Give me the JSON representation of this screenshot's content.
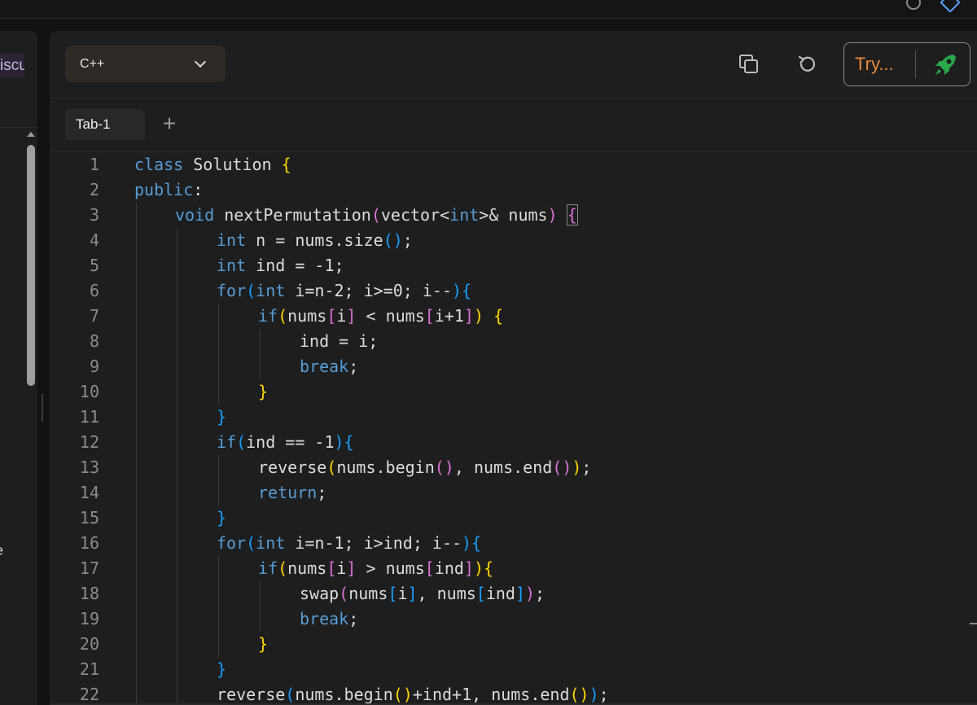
{
  "left_panel": {
    "tab_label": "iscu"
  },
  "editor": {
    "language": "C++",
    "try_label": "Try...",
    "tabs": [
      {
        "label": "Tab-1"
      }
    ],
    "add_tab_label": "+",
    "code_lines": [
      {
        "n": "1",
        "indent": 0,
        "html": "<span class=\"kw\">class</span> Solution <span class=\"b1\">{</span>"
      },
      {
        "n": "2",
        "indent": 0,
        "html": "<span class=\"kw\">public</span>:"
      },
      {
        "n": "3",
        "indent": 1,
        "html": "<span class=\"kw\">void</span> nextPermutation<span class=\"b2\">(</span>vector&lt;<span class=\"kw\">int</span>&gt;&amp; nums<span class=\"b2\">)</span> <span class=\"b2 hl\">{</span>"
      },
      {
        "n": "4",
        "indent": 2,
        "html": "<span class=\"kw\">int</span> n = nums.size<span class=\"b3\">()</span>;"
      },
      {
        "n": "5",
        "indent": 2,
        "html": "<span class=\"kw\">int</span> ind = -1;"
      },
      {
        "n": "6",
        "indent": 2,
        "html": "<span class=\"kw\">for</span><span class=\"b3\">(</span><span class=\"kw\">int</span> i=n-2; i&gt;=0; i--<span class=\"b3\">){</span>"
      },
      {
        "n": "7",
        "indent": 3,
        "html": "<span class=\"kw\">if</span><span class=\"b1\">(</span>nums<span class=\"b2\">[</span>i<span class=\"b2\">]</span> &lt; nums<span class=\"b2\">[</span>i+1<span class=\"b2\">]</span><span class=\"b1\">)</span> <span class=\"b1\">{</span>"
      },
      {
        "n": "8",
        "indent": 4,
        "html": "ind = i;"
      },
      {
        "n": "9",
        "indent": 4,
        "html": "<span class=\"kw\">break</span>;"
      },
      {
        "n": "10",
        "indent": 3,
        "html": "<span class=\"b1\">}</span>"
      },
      {
        "n": "11",
        "indent": 2,
        "html": "<span class=\"b3\">}</span>"
      },
      {
        "n": "12",
        "indent": 2,
        "html": "<span class=\"kw\">if</span><span class=\"b3\">(</span>ind == -1<span class=\"b3\">){</span>"
      },
      {
        "n": "13",
        "indent": 3,
        "html": "reverse<span class=\"b1\">(</span>nums.begin<span class=\"b2\">()</span>, nums.end<span class=\"b2\">()</span><span class=\"b1\">)</span>;"
      },
      {
        "n": "14",
        "indent": 3,
        "html": "<span class=\"kw\">return</span>;"
      },
      {
        "n": "15",
        "indent": 2,
        "html": "<span class=\"b3\">}</span>"
      },
      {
        "n": "16",
        "indent": 2,
        "html": "<span class=\"kw\">for</span><span class=\"b3\">(</span><span class=\"kw\">int</span> i=n-1; i&gt;ind; i--<span class=\"b3\">){</span>"
      },
      {
        "n": "17",
        "indent": 3,
        "html": "<span class=\"kw\">if</span><span class=\"b1\">(</span>nums<span class=\"b2\">[</span>i<span class=\"b2\">]</span> &gt; nums<span class=\"b2\">[</span>ind<span class=\"b2\">]</span><span class=\"b1\">){</span>"
      },
      {
        "n": "18",
        "indent": 4,
        "html": "swap<span class=\"b2\">(</span>nums<span class=\"b3\">[</span>i<span class=\"b3\">]</span>, nums<span class=\"b3\">[</span>ind<span class=\"b3\">]</span><span class=\"b2\">)</span>;"
      },
      {
        "n": "19",
        "indent": 4,
        "html": "<span class=\"kw\">break</span>;"
      },
      {
        "n": "20",
        "indent": 3,
        "html": "<span class=\"b1\">}</span>"
      },
      {
        "n": "21",
        "indent": 2,
        "html": "<span class=\"b3\">}</span>"
      },
      {
        "n": "22",
        "indent": 2,
        "html": "reverse<span class=\"b3\">(</span>nums.begin<span class=\"b1\">()</span>+ind+1, nums.end<span class=\"b1\">()</span><span class=\"b3\">)</span>;"
      }
    ]
  },
  "icons": {
    "copy": "copy-icon",
    "reset": "reset-icon",
    "rocket": "rocket-icon",
    "chevron": "chevron-down-icon"
  },
  "colors": {
    "background": "#1e1e1e",
    "keyword": "#569cd6",
    "bracket_gold": "#ffd700",
    "bracket_magenta": "#da70d6",
    "bracket_blue": "#179fff",
    "try_text": "#e88a3a",
    "rocket": "#2aa84a"
  }
}
